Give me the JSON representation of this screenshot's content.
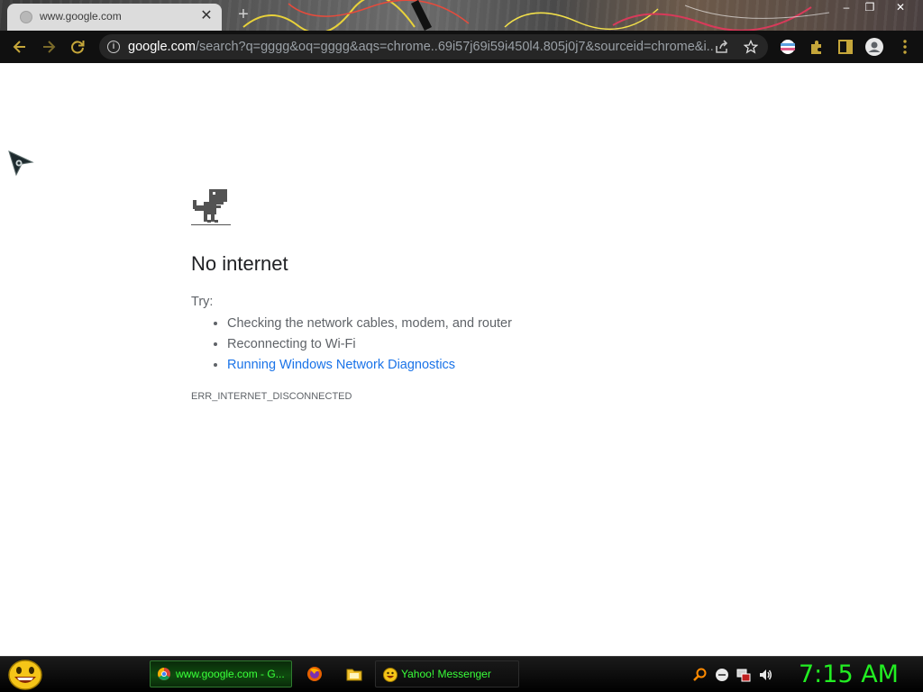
{
  "browser": {
    "tab": {
      "title": "www.google.com"
    },
    "window_controls": {
      "minimize": "–",
      "restore": "❐",
      "close": "✕"
    },
    "address": {
      "host": "google.com",
      "path": "/search?q=gggg&oq=gggg&aqs=chrome..69i57j69i59i450l4.805j0j7&sourceid=chrome&i..."
    }
  },
  "error_page": {
    "heading": "No internet",
    "try_label": "Try:",
    "suggestions": [
      "Checking the network cables, modem, and router",
      "Reconnecting to Wi-Fi",
      "Running Windows Network Diagnostics"
    ],
    "error_code": "ERR_INTERNET_DISCONNECTED"
  },
  "taskbar": {
    "buttons": [
      {
        "label": "www.google.com - G...",
        "icon": "chrome-icon",
        "active": true
      },
      {
        "label": "Yahoo! Messenger",
        "icon": "yahoo-messenger-icon",
        "active": false
      }
    ],
    "quick_launch": [
      "firefox-icon",
      "folder-icon"
    ],
    "tray": [
      "search-icon",
      "network-icon",
      "display-icon",
      "volume-icon"
    ],
    "clock": "7:15 AM"
  },
  "colors": {
    "link": "#1a73e8",
    "clock": "#22ee22",
    "taskbar_text": "#39ff39"
  }
}
